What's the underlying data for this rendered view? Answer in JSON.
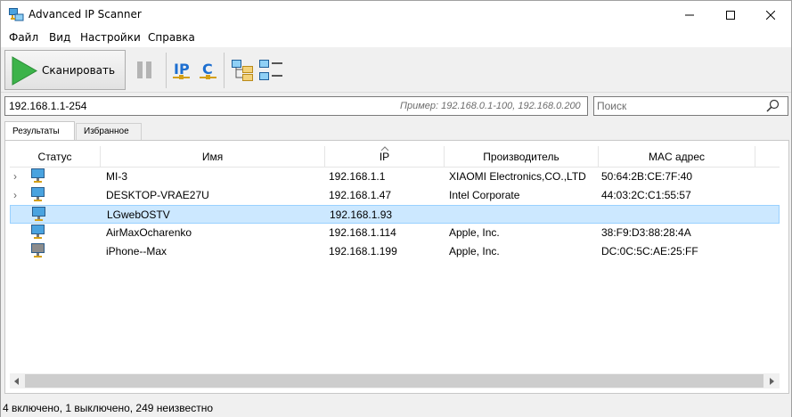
{
  "window": {
    "title": "Advanced IP Scanner"
  },
  "menu": [
    "Файл",
    "Вид",
    "Настройки",
    "Справка"
  ],
  "toolbar": {
    "scan_label": "Сканировать"
  },
  "address": {
    "value": "192.168.1.1-254",
    "hint": "Пример: 192.168.0.1-100, 192.168.0.200"
  },
  "search": {
    "placeholder": "Поиск"
  },
  "tabs": [
    {
      "label": "Результаты",
      "active": true
    },
    {
      "label": "Избранное",
      "active": false
    }
  ],
  "columns": [
    "Статус",
    "Имя",
    "IP",
    "Производитель",
    "MAC адрес"
  ],
  "rows": [
    {
      "expandable": true,
      "status": "online",
      "name": "MI-3",
      "ip": "192.168.1.1",
      "vendor": "XIAOMI Electronics,CO.,LTD",
      "mac": "50:64:2B:CE:7F:40",
      "selected": false
    },
    {
      "expandable": true,
      "status": "online",
      "name": "DESKTOP-VRAE27U",
      "ip": "192.168.1.47",
      "vendor": "Intel Corporate",
      "mac": "44:03:2C:C1:55:57",
      "selected": false
    },
    {
      "expandable": false,
      "status": "online",
      "name": "LGwebOSTV",
      "ip": "192.168.1.93",
      "vendor": "",
      "mac": "",
      "selected": true
    },
    {
      "expandable": false,
      "status": "online",
      "name": "AirMaxOcharenko",
      "ip": "192.168.1.114",
      "vendor": "Apple, Inc.",
      "mac": "38:F9:D3:88:28:4A",
      "selected": false
    },
    {
      "expandable": false,
      "status": "offline",
      "name": "iPhone--Max",
      "ip": "192.168.1.199",
      "vendor": "Apple, Inc.",
      "mac": "DC:0C:5C:AE:25:FF",
      "selected": false
    }
  ],
  "status": "4 включено, 1 выключено, 249 неизвестно",
  "colors": {
    "accent": "#0078d7",
    "selection": "#cce8ff",
    "scan_green": "#3cb34a"
  }
}
